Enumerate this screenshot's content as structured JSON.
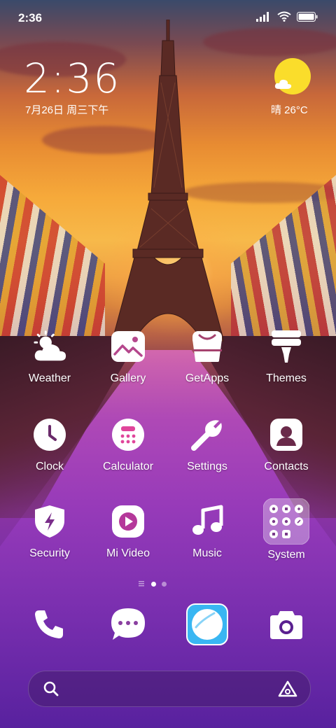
{
  "status_bar": {
    "time": "2:36",
    "icons": [
      "signal-icon",
      "wifi-icon",
      "battery-icon"
    ]
  },
  "clock_widget": {
    "time": "2:36",
    "date": "7月26日 周三下午"
  },
  "weather_widget": {
    "condition_icon": "sun-cloud-icon",
    "text": "晴 26°C"
  },
  "apps": [
    {
      "label": "Weather",
      "icon": "weather-icon"
    },
    {
      "label": "Gallery",
      "icon": "gallery-icon"
    },
    {
      "label": "GetApps",
      "icon": "getapps-icon"
    },
    {
      "label": "Themes",
      "icon": "themes-icon"
    },
    {
      "label": "Clock",
      "icon": "clock-icon"
    },
    {
      "label": "Calculator",
      "icon": "calculator-icon"
    },
    {
      "label": "Settings",
      "icon": "settings-icon"
    },
    {
      "label": "Contacts",
      "icon": "contacts-icon"
    },
    {
      "label": "Security",
      "icon": "security-icon"
    },
    {
      "label": "Mi Video",
      "icon": "mi-video-icon"
    },
    {
      "label": "Music",
      "icon": "music-icon"
    },
    {
      "label": "System",
      "icon": "system-folder-icon"
    }
  ],
  "page_indicator": {
    "pages": 2,
    "active": 1
  },
  "dock": [
    {
      "icon": "phone-icon"
    },
    {
      "icon": "messages-icon"
    },
    {
      "icon": "browser-icon"
    },
    {
      "icon": "camera-icon"
    }
  ],
  "search_bar": {
    "left_icon": "search-icon",
    "right_icon": "assistant-icon"
  },
  "colors": {
    "accent_sun": "#fadd2b",
    "browser_icon_bg": "#39b6f2"
  }
}
